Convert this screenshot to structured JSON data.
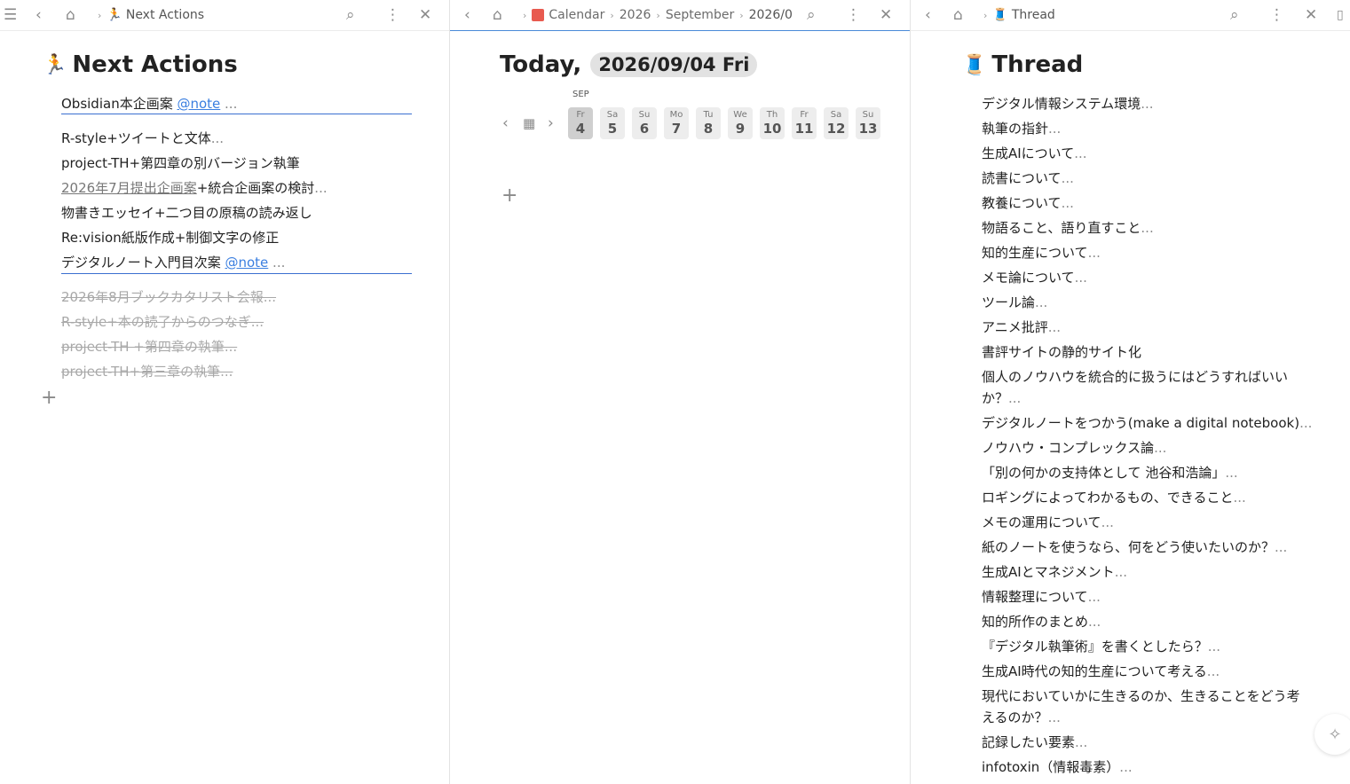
{
  "left_pane": {
    "breadcrumb_title": "Next Actions",
    "heading": "Next Actions",
    "project_row": {
      "text": "Obsidian本企画案 ",
      "tag": "@note",
      "ellipsis": " ..."
    },
    "actions": [
      {
        "text": "R-style+ツイートと文体",
        "ellipsis": "..."
      },
      {
        "text": "project-TH+第四章の別バージョン執筆",
        "ellipsis": ""
      },
      {
        "link": "2026年7月提出企画案",
        "text": "+統合企画案の検討",
        "ellipsis": "..."
      },
      {
        "text": "物書きエッセイ+二つ目の原稿の読み返し",
        "ellipsis": ""
      },
      {
        "text": "Re:vision紙版作成+制御文字の修正",
        "ellipsis": ""
      }
    ],
    "project_row2": {
      "text": "デジタルノート入門目次案 ",
      "tag": "@note",
      "ellipsis": " ..."
    },
    "completed": [
      "2026年8月ブックカタリスト会報...",
      "R-style+本の読了からのつなぎ...",
      "project-TH +第四章の執筆...",
      "project-TH+第三章の執筆..."
    ],
    "add_symbol": "+"
  },
  "middle_pane": {
    "breadcrumbs": [
      "Calendar",
      "2026",
      "September",
      "2026/0"
    ],
    "heading_prefix": "Today,",
    "heading_date": "2026/09/04 Fri",
    "month_label": "SEP",
    "days": [
      {
        "name": "Fr",
        "num": "4",
        "selected": true
      },
      {
        "name": "Sa",
        "num": "5"
      },
      {
        "name": "Su",
        "num": "6"
      },
      {
        "name": "Mo",
        "num": "7"
      },
      {
        "name": "Tu",
        "num": "8"
      },
      {
        "name": "We",
        "num": "9"
      },
      {
        "name": "Th",
        "num": "10"
      },
      {
        "name": "Fr",
        "num": "11"
      },
      {
        "name": "Sa",
        "num": "12"
      },
      {
        "name": "Su",
        "num": "13"
      }
    ],
    "add_symbol": "+"
  },
  "right_pane": {
    "breadcrumb_title": "Thread",
    "heading": "Thread",
    "items": [
      {
        "text": "デジタル情報システム環境",
        "ellipsis": "..."
      },
      {
        "text": "執筆の指針",
        "ellipsis": "..."
      },
      {
        "text": "生成AIについて",
        "ellipsis": "..."
      },
      {
        "text": "読書について",
        "ellipsis": "..."
      },
      {
        "text": "教養について",
        "ellipsis": "..."
      },
      {
        "text": "物語ること、語り直すこと",
        "ellipsis": "..."
      },
      {
        "text": "知的生産について",
        "ellipsis": "..."
      },
      {
        "text": "メモ論について",
        "ellipsis": "..."
      },
      {
        "text": "ツール論",
        "ellipsis": "..."
      },
      {
        "text": "アニメ批評",
        "ellipsis": "..."
      },
      {
        "text": "書評サイトの静的サイト化",
        "ellipsis": ""
      },
      {
        "text": "個人のノウハウを統合的に扱うにはどうすればいいか？",
        "ellipsis": "..."
      },
      {
        "text": "デジタルノートをつかう(make a digital notebook)",
        "ellipsis": "..."
      },
      {
        "text": "ノウハウ・コンプレックス論",
        "ellipsis": "..."
      },
      {
        "text": "「別の何かの支持体として 池谷和浩論」",
        "ellipsis": "..."
      },
      {
        "text": "ロギングによってわかるもの、できること",
        "ellipsis": "..."
      },
      {
        "text": "メモの運用について",
        "ellipsis": "..."
      },
      {
        "text": "紙のノートを使うなら、何をどう使いたいのか？",
        "ellipsis": "..."
      },
      {
        "text": "生成AIとマネジメント",
        "ellipsis": "..."
      },
      {
        "text": "情報整理について",
        "ellipsis": "..."
      },
      {
        "text": "知的所作のまとめ",
        "ellipsis": "..."
      },
      {
        "text": "『デジタル執筆術』を書くとしたら？",
        "ellipsis": "..."
      },
      {
        "text": "生成AI時代の知的生産について考える",
        "ellipsis": "..."
      },
      {
        "text": "現代においていかに生きるのか、生きることをどう考えるのか？",
        "ellipsis": "..."
      },
      {
        "text": "記録したい要素",
        "ellipsis": "..."
      },
      {
        "text": "infotoxin（情報毒素）",
        "ellipsis": "..."
      }
    ]
  }
}
